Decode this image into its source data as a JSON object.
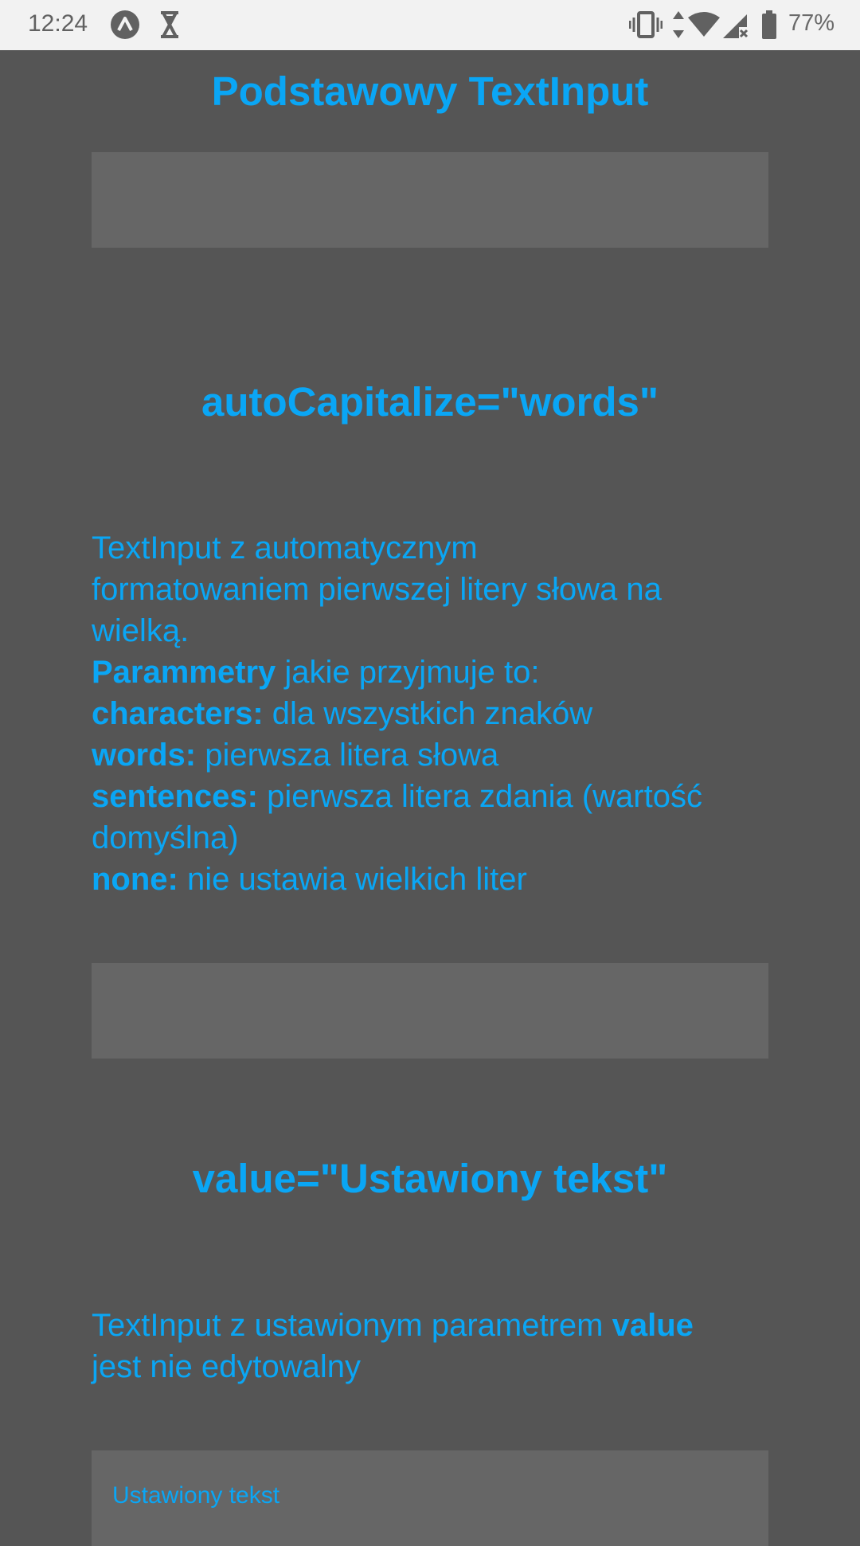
{
  "status_bar": {
    "time": "12:24",
    "battery_percent": "77%",
    "icons": [
      "app-logo-icon",
      "hourglass-icon",
      "vibrate-icon",
      "data-arrows-icon",
      "wifi-icon",
      "signal-no-sim-icon",
      "battery-icon"
    ]
  },
  "section1": {
    "title": "Podstawowy TextInput",
    "input_value": ""
  },
  "section2": {
    "title": "autoCapitalize=\"words\"",
    "desc_line1": "TextInput z automatycznym",
    "desc_line2": "formatowaniem pierwszej litery słowa na",
    "desc_line3": "wielką.",
    "params_bold": "Parammetry",
    "params_rest": " jakie przyjmuje to:",
    "characters_bold": "characters:",
    "characters_rest": " dla wszystkich znaków",
    "words_bold": "words:",
    "words_rest": " pierwsza litera słowa",
    "sentences_bold": "sentences:",
    "sentences_rest": " pierwsza litera zdania (wartość",
    "sentences_rest2": "domyślna)",
    "none_bold": "none:",
    "none_rest": " nie ustawia wielkich liter",
    "input_value": ""
  },
  "section3": {
    "title": "value=\"Ustawiony tekst\"",
    "desc_part1": "TextInput z ustawionym parametrem ",
    "desc_bold": "value",
    "desc_line2": "jest nie edytowalny",
    "input_value": "Ustawiony tekst"
  },
  "colors": {
    "background": "#555555",
    "input_background": "#666666",
    "accent": "#0aa6f5",
    "status_bar": "#f2f2f2"
  }
}
